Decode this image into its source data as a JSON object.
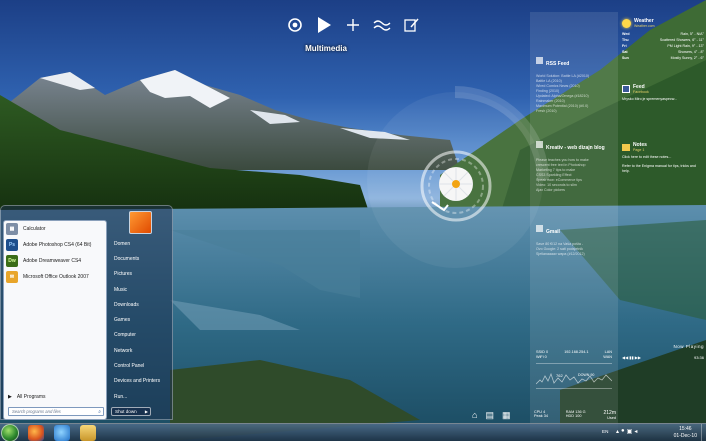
{
  "multimedia": {
    "title": "Multimedia",
    "buttons": [
      "settings-icon",
      "play-icon",
      "add-icon",
      "equalizer-icon",
      "edit-icon"
    ]
  },
  "weather": {
    "title": "Weather",
    "subtitle": "Weather.com",
    "days": [
      {
        "day": "Wed",
        "desc": "Rain, 5° - N/A°"
      },
      {
        "day": "Thu",
        "desc": "Scattered Showers, 6° - 11°"
      },
      {
        "day": "Fri",
        "desc": "PM Light Rain, 9° - 13°"
      },
      {
        "day": "Sat",
        "desc": "Showers, 4° - 8°"
      },
      {
        "day": "Sun",
        "desc": "Mostly Sunny, 2° - 6°"
      }
    ]
  },
  "feed": {
    "title": "Feed",
    "subtitle": "Facebook",
    "text": "Mrysko Miro je spremenyaspecw..."
  },
  "notes": {
    "title": "Notes",
    "subtitle": "Page 1",
    "line1": "Click here to edit these notes...",
    "line2": "Refer to the Enigma manual for tips, tricks and help."
  },
  "rss": {
    "title": "RSS Feed",
    "lines": [
      "World Solution: Battle LA (#2010)",
      "Battle LA (2010)",
      "Wired Comics News (2010)",
      "Finding (2010)",
      "Updated: Alpha/Omega (#18210)",
      "Rainmaker (2010)",
      "Maximum Potential (2010) (#0.0)",
      "Fresh (2010)"
    ]
  },
  "blog": {
    "title": "Kreativ - web dizajn blog",
    "lines": [
      "Please teaches you how to make",
      "crescent free text in Photoshop",
      "Marketing 7 tips to make",
      "CSS3 Sparkling Effect",
      "Speak now: eCommerce tips",
      "Video: 10 seconds to slim",
      "Ajax Color pickers"
    ]
  },
  "gmail": {
    "title": "Gmail",
    "lines": [
      "Save 80 €/12 na Vaša pošta -",
      "Ovo Google: 2 sati podsjetnik",
      "Sjetlanaaaav wapa (#12/2012)"
    ]
  },
  "nowplaying": {
    "title": "Now Playing",
    "time": "93:36"
  },
  "system": {
    "ssid_label": "SSID",
    "ssid_val": "0",
    "wifi_label": "WiFi",
    "wifi_val": "0",
    "ip": "192.168.254.1",
    "lan_label": "LAN",
    "wan_label": "WAN",
    "graph_val1": "762",
    "graph_label": "DOWN",
    "graph_val2": "90",
    "cpu_label": "CPU",
    "cpu_val": "4",
    "ram_label": "RAM",
    "ram_val": "136 G",
    "ram2_label": "Peak",
    "ram2_val": "34",
    "hdd_label": "HDD",
    "hdd_val": "100",
    "disk_val": "212m",
    "disk_label": "Used"
  },
  "start_menu": {
    "apps": [
      {
        "name": "Calculator",
        "icon": "calculator-icon",
        "abbr": "",
        "color": "#7d8ea6"
      },
      {
        "name": "Adobe Photoshop CS4 (64 Bit)",
        "icon": "photoshop-icon",
        "abbr": "Ps",
        "color": "#1e4f8d"
      },
      {
        "name": "Adobe Dreamweaver CS4",
        "icon": "dreamweaver-icon",
        "abbr": "Dw",
        "color": "#3b6d18"
      },
      {
        "name": "Microsoft Office Outlook 2007",
        "icon": "outlook-icon",
        "abbr": "",
        "color": "#e8a52a"
      }
    ],
    "all_programs": "All Programs",
    "search_placeholder": "Search programs and files",
    "right_links": [
      "Domen",
      "Documents",
      "Pictures",
      "Music",
      "Downloads",
      "Games",
      "Computer",
      "Network",
      "Control Panel",
      "Devices and Printers",
      "Run..."
    ],
    "shutdown_label": "Shut down"
  },
  "taskbar": {
    "items": [
      "firefox-icon",
      "ie-icon",
      "explorer-icon"
    ],
    "lang": "EN",
    "time": "15:46",
    "date": "01-Dec-10"
  }
}
